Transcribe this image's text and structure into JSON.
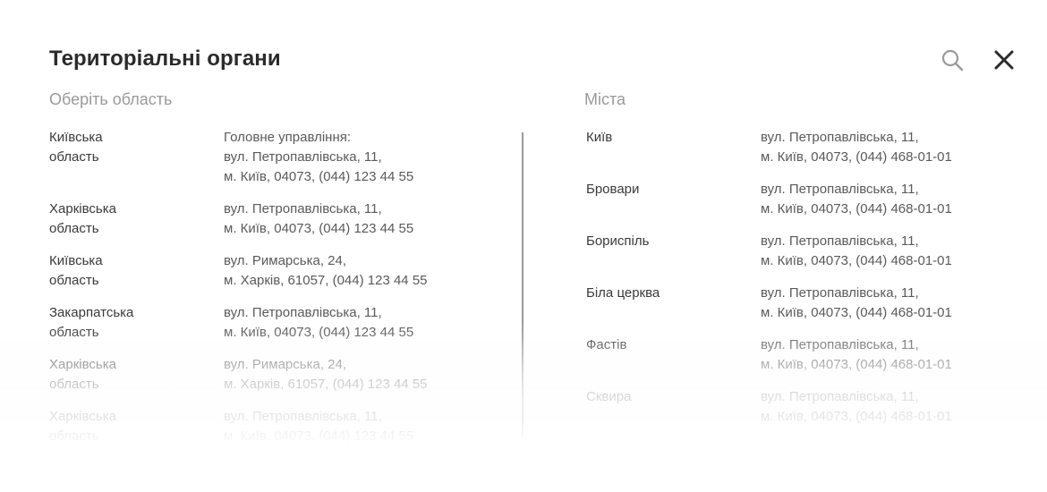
{
  "header": {
    "title": "Територіальні органи",
    "search_icon": "search-icon",
    "close_icon": "close-icon"
  },
  "regions": {
    "heading": "Оберіть область",
    "items": [
      {
        "name": "Київська\nобласть",
        "address": [
          "Головне управління:",
          "вул. Петропавлівська, 11,",
          "м. Київ, 04073, (044) 123 44 55"
        ]
      },
      {
        "name": "Харківська\nобласть",
        "address": [
          "вул. Петропавлівська, 11,",
          "м. Київ, 04073, (044) 123 44 55"
        ]
      },
      {
        "name": "Київська\nобласть",
        "address": [
          "вул. Римарська, 24,",
          "м. Харків, 61057, (044) 123 44 55"
        ]
      },
      {
        "name": "Закарпатська\nобласть",
        "address": [
          "вул. Петропавлівська, 11,",
          "м. Київ, 04073, (044) 123 44 55"
        ]
      },
      {
        "name": "Харківська\nобласть",
        "address": [
          "вул. Римарська, 24,",
          "м. Харків, 61057, (044) 123 44 55"
        ]
      },
      {
        "name": "Харківська\nобласть",
        "address": [
          "вул. Петропавлівська, 11,",
          "м. Київ, 04073, (044) 123 44 55"
        ]
      }
    ]
  },
  "cities": {
    "heading": "Міста",
    "items": [
      {
        "name": "Київ",
        "address": [
          "вул. Петропавлівська, 11,",
          "м. Київ, 04073, (044) 468-01-01"
        ]
      },
      {
        "name": "Бровари",
        "address": [
          "вул. Петропавлівська, 11,",
          "м. Київ, 04073, (044) 468-01-01"
        ]
      },
      {
        "name": "Бориспіль",
        "address": [
          "вул. Петропавлівська, 11,",
          "м. Київ, 04073, (044) 468-01-01"
        ]
      },
      {
        "name": "Біла церква",
        "address": [
          "вул. Петропавлівська, 11,",
          "м. Київ, 04073, (044) 468-01-01"
        ]
      },
      {
        "name": "Фастів",
        "address": [
          "вул. Петропавлівська, 11,",
          "м. Київ, 04073, (044) 468-01-01"
        ]
      },
      {
        "name": "Сквира",
        "address": [
          "вул. Петропавлівська, 11,",
          "м. Київ, 04073, (044) 468-01-01"
        ]
      }
    ]
  },
  "colors": {
    "title": "#2b2b2b",
    "heading": "#9a9a9a",
    "text": "#3a3a3a",
    "divider": "#9a9a9a"
  }
}
